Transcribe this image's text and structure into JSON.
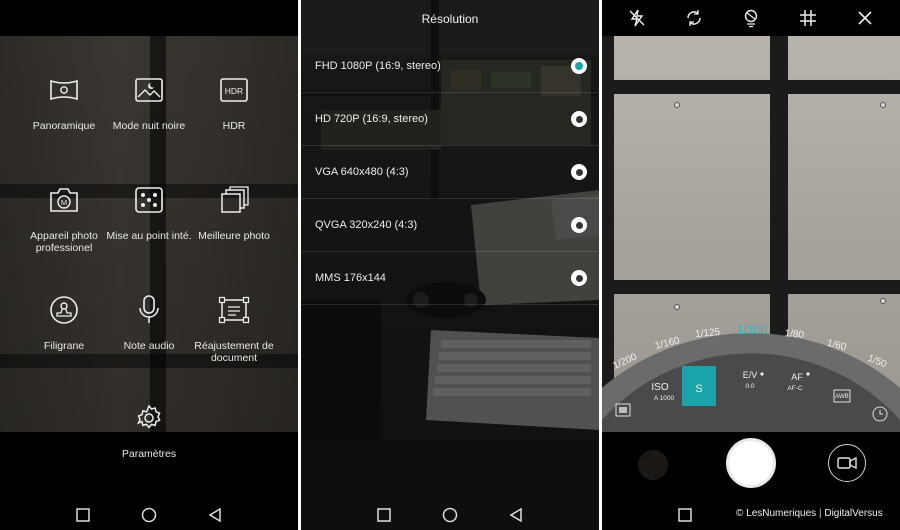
{
  "modes_screen": {
    "items": [
      {
        "label": "Panoramique",
        "icon": "panorama-icon"
      },
      {
        "label": "Mode nuit noire",
        "icon": "night-mode-icon"
      },
      {
        "label": "HDR",
        "icon": "hdr-icon",
        "icon_text": "HDR"
      },
      {
        "label": "Appareil photo professionel",
        "icon": "pro-camera-icon",
        "icon_text": "M"
      },
      {
        "label": "Mise au point inté.",
        "icon": "refocus-icon"
      },
      {
        "label": "Meilleure photo",
        "icon": "best-photo-icon"
      },
      {
        "label": "Filigrane",
        "icon": "watermark-stamp-icon"
      },
      {
        "label": "Note audio",
        "icon": "microphone-icon"
      },
      {
        "label": "Réajustement de document",
        "icon": "document-adjust-icon"
      },
      {
        "label": "Paramètres",
        "icon": "gear-icon"
      }
    ]
  },
  "resolution_screen": {
    "title": "Résolution",
    "options": [
      {
        "label": "FHD 1080P (16:9, stereo)",
        "selected": true
      },
      {
        "label": "HD 720P (16:9, stereo)",
        "selected": false
      },
      {
        "label": "VGA 640x480 (4:3)",
        "selected": false
      },
      {
        "label": "QVGA 320x240 (4:3)",
        "selected": false
      },
      {
        "label": "MMS 176x144",
        "selected": false
      }
    ]
  },
  "pro_camera": {
    "top_icons": [
      "flash-off-icon",
      "rotate-camera-icon",
      "filter-icon",
      "grid-icon",
      "close-icon"
    ],
    "shutter_speeds": [
      "1/200",
      "1/160",
      "1/125",
      "1/100",
      "1/80",
      "1/60",
      "1/50"
    ],
    "selected_speed": "1/100",
    "params": {
      "iso_label": "ISO",
      "iso_value": "A 1000",
      "s_label": "S",
      "ev_label": "E/V",
      "ev_value": "0.0",
      "af_label": "AF",
      "af_value": "AF-C",
      "awb_label": "AWB"
    }
  },
  "watermark": {
    "left": "© LesNumeriques",
    "separator": "|",
    "right": "DigitalVersus"
  },
  "colors": {
    "accent": "#1aa3a8",
    "dial": "#6b6b6b",
    "dial_dark": "#4a4a4a"
  },
  "nav_icons": [
    "recent-apps-icon",
    "home-icon",
    "back-icon"
  ]
}
